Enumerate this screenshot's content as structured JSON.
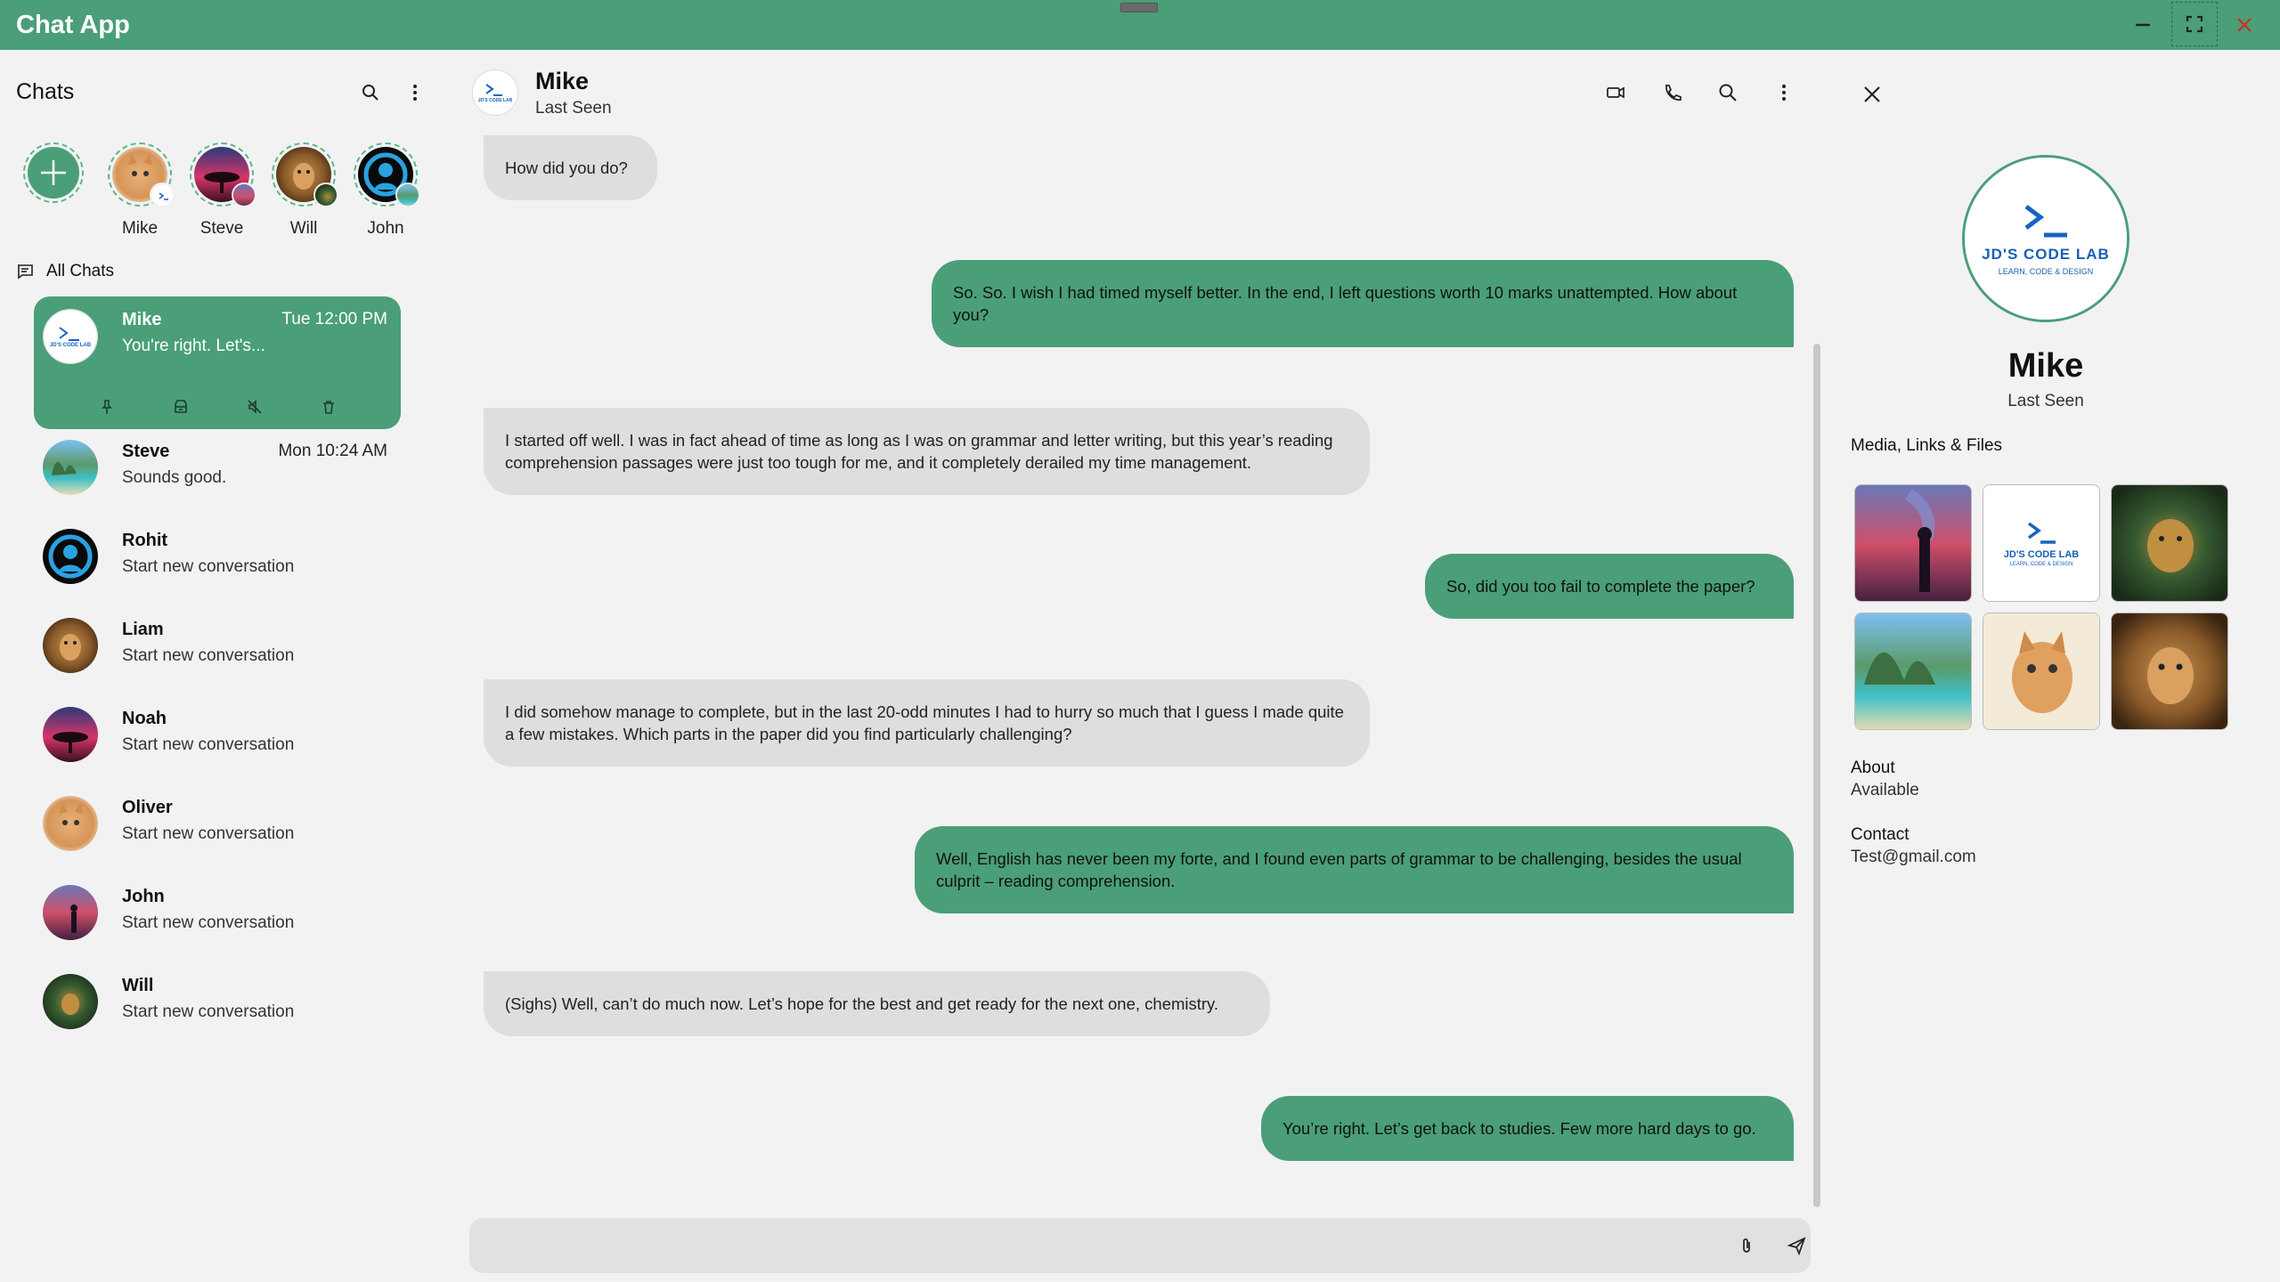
{
  "app": {
    "title": "Chat App"
  },
  "sidebar": {
    "title": "Chats",
    "all_chats_label": "All Chats",
    "stories": [
      {
        "name": "Mike"
      },
      {
        "name": "Steve"
      },
      {
        "name": "Will"
      },
      {
        "name": "John"
      }
    ],
    "chats": [
      {
        "name": "Mike",
        "preview": "You're right. Let's...",
        "time": "Tue 12:00 PM",
        "selected": true
      },
      {
        "name": "Steve",
        "preview": "Sounds good.",
        "time": "Mon 10:24 AM"
      },
      {
        "name": "Rohit",
        "preview": "Start new conversation",
        "time": ""
      },
      {
        "name": "Liam",
        "preview": "Start new conversation",
        "time": ""
      },
      {
        "name": "Noah",
        "preview": "Start new conversation",
        "time": ""
      },
      {
        "name": "Oliver",
        "preview": "Start new conversation",
        "time": ""
      },
      {
        "name": "John",
        "preview": "Start new conversation",
        "time": ""
      },
      {
        "name": "Will",
        "preview": "Start new conversation",
        "time": ""
      }
    ]
  },
  "conversation": {
    "name": "Mike",
    "status": "Last Seen",
    "messages": [
      {
        "dir": "in",
        "text": "How did you do?"
      },
      {
        "dir": "out",
        "text": "So. So. I wish I had timed myself better. In the end, I left questions worth 10 marks unattempted. How about you?"
      },
      {
        "dir": "in",
        "text": "I started off well. I was in fact ahead of time as long as I was on grammar and letter writing, but this year’s reading comprehension passages were just too tough for me, and it completely derailed my time management."
      },
      {
        "dir": "out",
        "text": "So, did you too fail to complete the paper?"
      },
      {
        "dir": "in",
        "text": " I did somehow manage to complete, but in the last 20-odd minutes I had to hurry so much that I guess I made quite a few mistakes. Which parts in the paper did you find particularly challenging?"
      },
      {
        "dir": "out",
        "text": "Well, English has never been my forte, and I found even parts of grammar to be challenging, besides the usual culprit – reading comprehension."
      },
      {
        "dir": "in",
        "text": "(Sighs) Well, can’t do much now. Let’s hope for the best and get ready for the next one, chemistry."
      },
      {
        "dir": "out",
        "text": "You’re right. Let’s get back to studies. Few more hard days to go."
      }
    ],
    "composer": {
      "value": "",
      "placeholder": ""
    }
  },
  "profile": {
    "name": "Mike",
    "status": "Last Seen",
    "media_label": "Media, Links & Files",
    "about_label": "About",
    "about_value": "Available",
    "contact_label": "Contact",
    "contact_value": "Test@gmail.com"
  },
  "logo": {
    "line1": "JD'S CODE LAB",
    "line2": "LEARN, CODE & DESIGN"
  },
  "colors": {
    "accent": "#4a9f78",
    "incoming_bubble": "#dcdfdc",
    "background": "#f2f2f2"
  }
}
